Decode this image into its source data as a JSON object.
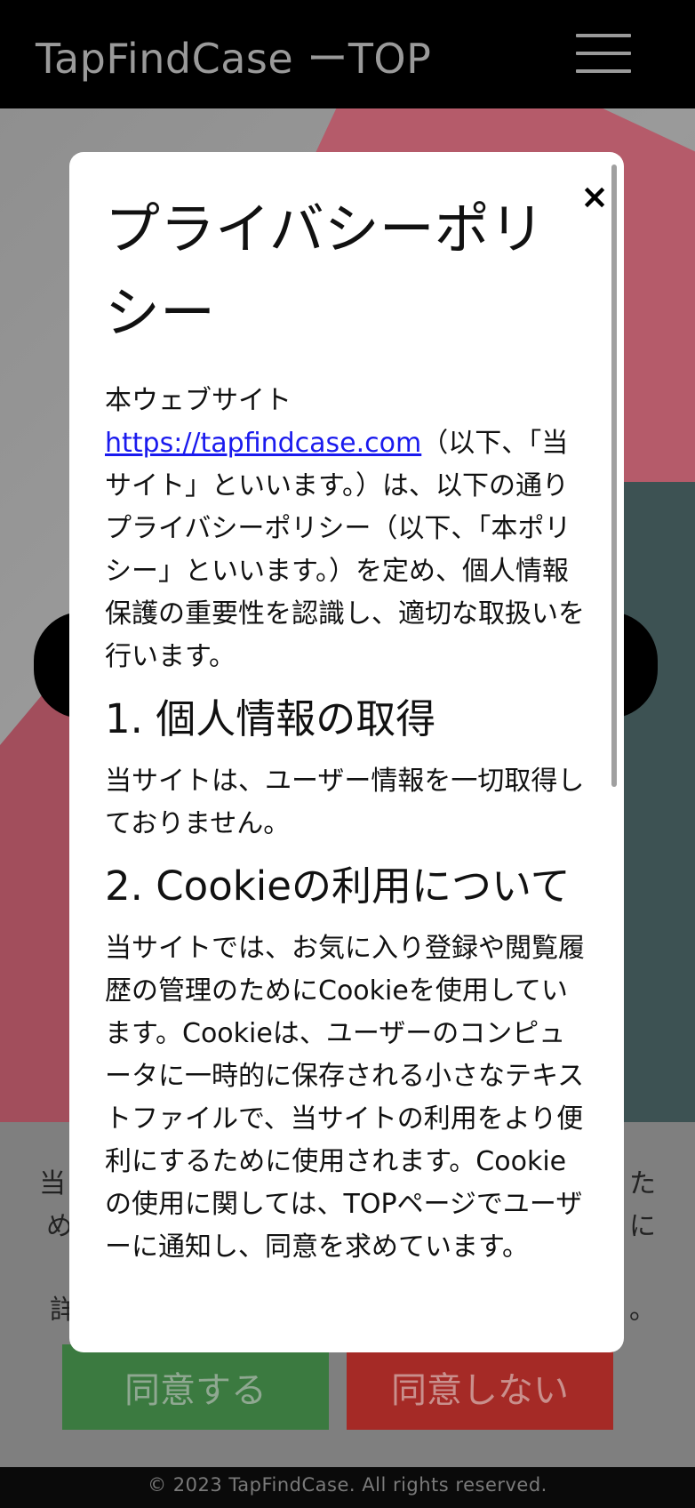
{
  "header": {
    "title": "TapFindCase ーTOP",
    "menu_icon": "hamburger-menu-icon"
  },
  "cookie_banner": {
    "text_left_1": "当",
    "text_left_2": "め",
    "text_right_1": "た",
    "text_right_2": "に",
    "detail_left": "詳",
    "detail_right": "。",
    "agree_label": "同意する",
    "disagree_label": "同意しない",
    "colors": {
      "agree": "#3b7a40",
      "disagree": "#a52a26"
    }
  },
  "footer": {
    "text": "© 2023 TapFindCase. All rights reserved."
  },
  "modal": {
    "close_label": "×",
    "title": "プライバシーポリシー",
    "intro_prefix": "本ウェブサイト",
    "intro_link": "https://tapfindcase.com",
    "intro_suffix": "（以下、「当サイト」といいます。）は、以下の通りプライバシーポリシー（以下、「本ポリシー」といいます。）を定め、個人情報保護の重要性を認識し、適切な取扱いを行います。",
    "section1_heading": "1. 個人情報の取得",
    "section1_body": "当サイトは、ユーザー情報を一切取得しておりません。",
    "section2_heading": "2. Cookieの利用について",
    "section2_body": "当サイトでは、お気に入り登録や閲覧履歴の管理のためにCookieを使用しています。Cookieは、ユーザーのコンピュータに一時的に保存される小さなテキストファイルで、当サイトの利用をより便利にするために使用されます。Cookieの使用に関しては、TOPページでユーザーに通知し、同意を求めています。"
  }
}
